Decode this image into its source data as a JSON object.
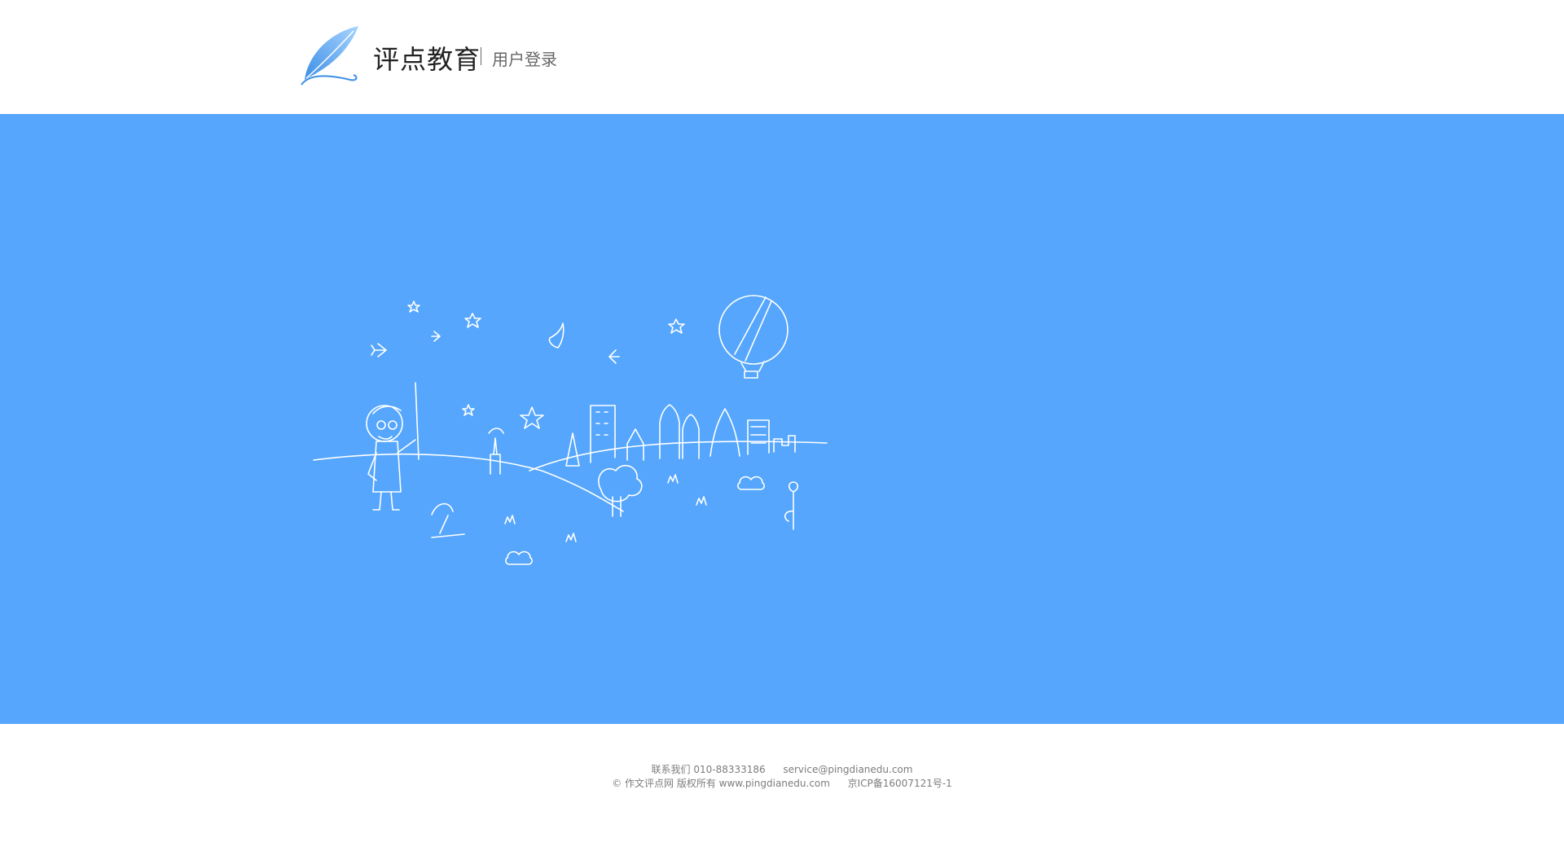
{
  "header": {
    "brand": "评点教育",
    "subtitle": "用户登录"
  },
  "icons": {
    "logo": "feather-quill-logo-icon",
    "illustration": "doodle-city-illustration-icon"
  },
  "colors": {
    "hero_background": "#55a6fc",
    "line_art": "#ffffff",
    "footer_text": "#7d7d7d"
  },
  "footer": {
    "contact_label": "联系我们",
    "phone": "010-88333186",
    "email": "service@pingdianedu.com",
    "copyright": "© 作文评点网 版权所有",
    "website": "www.pingdianedu.com",
    "icp": "京ICP备16007121号-1"
  }
}
